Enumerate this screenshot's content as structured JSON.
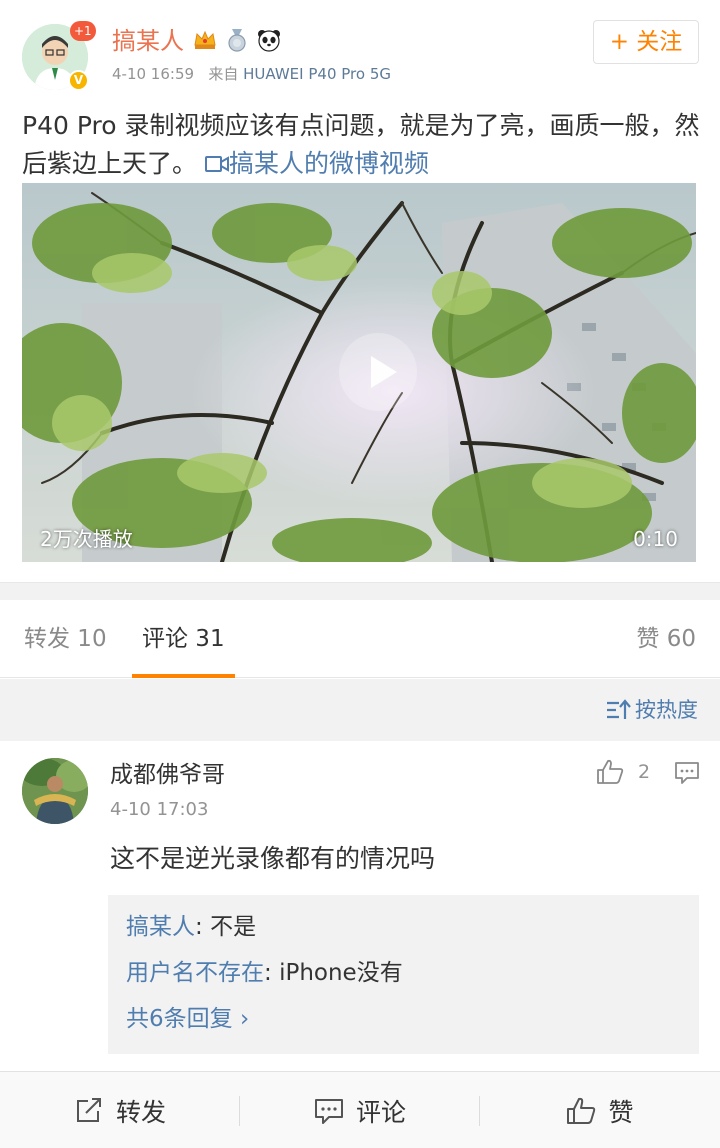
{
  "post": {
    "author": "搞某人",
    "avatar_badge": "+1",
    "verified_mark": "V",
    "time": "4-10 16:59",
    "source_prefix": "来自",
    "source": "HUAWEI P40 Pro 5G",
    "follow_label": "+ 关注",
    "text": "P40 Pro 录制视频应该有点问题，就是为了亮，画质一般，然后紫边上天了。",
    "video_link": "搞某人的微博视频",
    "video": {
      "plays": "2万次播放",
      "duration": "0:10"
    }
  },
  "tabs": {
    "repost": "转发 10",
    "comments": "评论 31",
    "likes": "赞 60"
  },
  "sort": {
    "label": "按热度"
  },
  "comment": {
    "name": "成都佛爷哥",
    "time": "4-10 17:03",
    "likes": "2",
    "text": "这不是逆光录像都有的情况吗",
    "replies": [
      {
        "who": "搞某人",
        "sep": ": ",
        "text": "不是"
      },
      {
        "who": "用户名不存在",
        "sep": ": ",
        "text": "iPhone没有"
      }
    ],
    "more": "共6条回复 ›"
  },
  "bottom_bar": {
    "repost": "转发",
    "comment": "评论",
    "like": "赞"
  },
  "colors": {
    "accent": "#ff8200",
    "username": "#eb7350",
    "link": "#507daf"
  }
}
